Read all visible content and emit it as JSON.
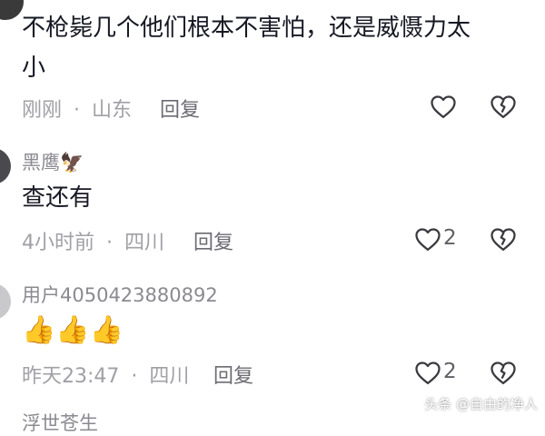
{
  "comments": [
    {
      "text_line1": "不枪毙几个他们根本不害怕，还是威慑力太",
      "text_line2": "小",
      "time": "刚刚",
      "sep": "·",
      "location": "山东",
      "reply_label": "回复",
      "like_count": ""
    },
    {
      "username": "黑鹰🦅",
      "text": "查还有",
      "time": "4小时前",
      "sep": "·",
      "location": "四川",
      "reply_label": "回复",
      "like_count": "2"
    },
    {
      "username": "用户4050423880892",
      "text": "👍👍👍",
      "time": "昨天23:47",
      "sep": "·",
      "location": "四川",
      "reply_label": "回复",
      "like_count": "2"
    },
    {
      "username": "浮世苍生"
    }
  ],
  "watermark": "头条 @自由的净人"
}
